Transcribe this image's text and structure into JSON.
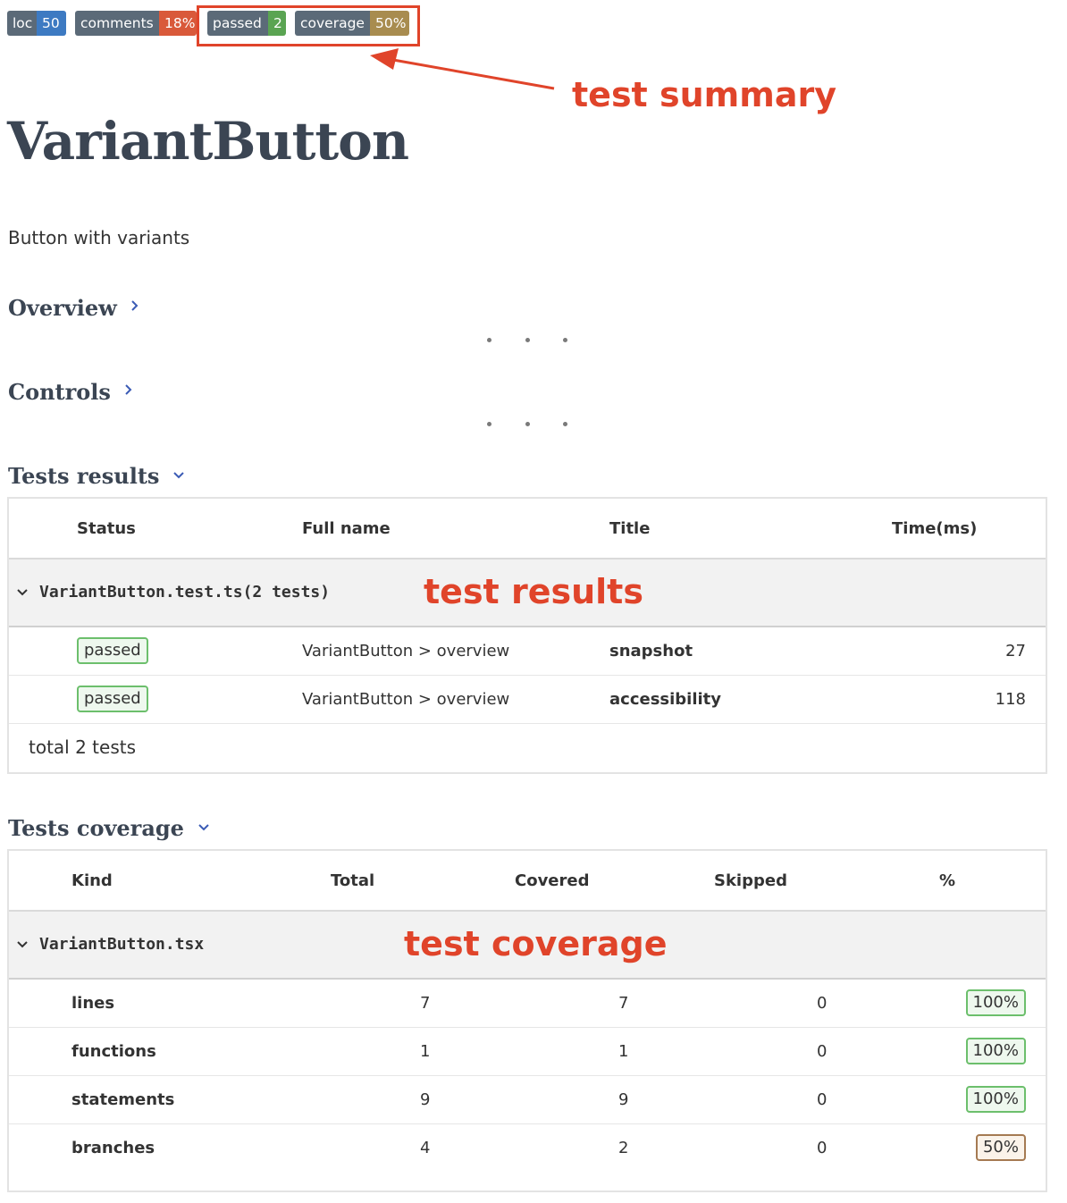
{
  "badges": {
    "loc": {
      "label": "loc",
      "value": "50",
      "color": "#3d7ac2"
    },
    "comments": {
      "label": "comments",
      "value": "18%",
      "color": "#d9593a"
    },
    "passed": {
      "label": "passed",
      "value": "2",
      "color": "#5aa452"
    },
    "coverage": {
      "label": "coverage",
      "value": "50%",
      "color": "#a88c4f"
    }
  },
  "annotations": {
    "summary": "test summary",
    "results": "test results",
    "coverage": "test coverage",
    "color": "#e0442a"
  },
  "component": {
    "title": "VariantButton",
    "description": "Button with variants"
  },
  "sections": {
    "overview": "Overview",
    "controls": "Controls",
    "tests_results": "Tests results",
    "tests_coverage": "Tests coverage"
  },
  "results_table": {
    "headers": [
      "Status",
      "Full name",
      "Title",
      "Time(ms)"
    ],
    "group": "VariantButton.test.ts(2 tests)",
    "rows": [
      {
        "status": "passed",
        "full_name": "VariantButton > overview",
        "title": "snapshot",
        "time": "27"
      },
      {
        "status": "passed",
        "full_name": "VariantButton > overview",
        "title": "accessibility",
        "time": "118"
      }
    ],
    "total": "total 2 tests"
  },
  "coverage_table": {
    "headers": [
      "Kind",
      "Total",
      "Covered",
      "Skipped",
      "%"
    ],
    "group": "VariantButton.tsx",
    "rows": [
      {
        "kind": "lines",
        "total": "7",
        "covered": "7",
        "skipped": "0",
        "pct": "100%"
      },
      {
        "kind": "functions",
        "total": "1",
        "covered": "1",
        "skipped": "0",
        "pct": "100%"
      },
      {
        "kind": "statements",
        "total": "9",
        "covered": "9",
        "skipped": "0",
        "pct": "100%"
      },
      {
        "kind": "branches",
        "total": "4",
        "covered": "2",
        "skipped": "0",
        "pct": "50%"
      }
    ]
  }
}
